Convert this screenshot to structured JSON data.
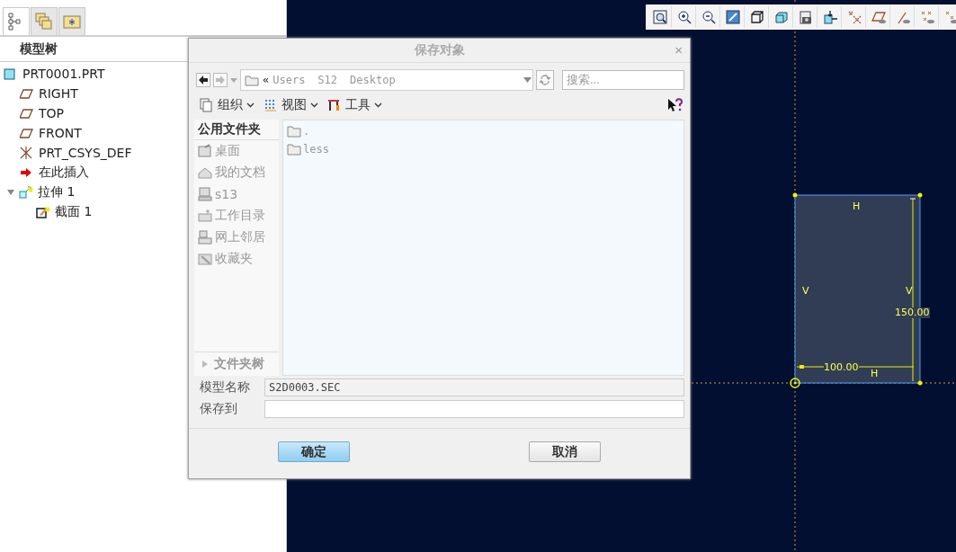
{
  "model_tree": {
    "tabs": [
      {
        "kind": "tree",
        "selected": true
      },
      {
        "kind": "layers",
        "selected": false
      },
      {
        "kind": "favorites",
        "selected": false
      }
    ],
    "title": "模型树",
    "items": [
      {
        "kind": "part",
        "label": "PRT0001.PRT",
        "children": [
          {
            "kind": "plane",
            "label": "RIGHT"
          },
          {
            "kind": "plane",
            "label": "TOP"
          },
          {
            "kind": "plane",
            "label": "FRONT"
          },
          {
            "kind": "csys",
            "label": "PRT_CSYS_DEF"
          },
          {
            "kind": "insert",
            "label": "在此插入"
          },
          {
            "kind": "extrude",
            "label": "拉伸 1",
            "expanded": true,
            "children": [
              {
                "kind": "sketch",
                "label": "截面 1"
              }
            ]
          }
        ]
      }
    ]
  },
  "dialog": {
    "title": "保存对象",
    "close": "×",
    "address": {
      "prefix": "«",
      "segments": [
        "Users",
        "S12",
        "Desktop"
      ]
    },
    "search": {
      "placeholder": "搜索..."
    },
    "menus": [
      {
        "kind": "organize",
        "label": "组织"
      },
      {
        "kind": "view",
        "label": "视图"
      },
      {
        "kind": "tools",
        "label": "工具"
      }
    ],
    "sidebar": {
      "heading": "公用文件夹",
      "items": [
        {
          "kind": "desktop",
          "label": "桌面"
        },
        {
          "kind": "documents",
          "label": "我的文档"
        },
        {
          "kind": "computer",
          "label": "s13"
        },
        {
          "kind": "workdir",
          "label": "工作目录"
        },
        {
          "kind": "network",
          "label": "网上邻居"
        },
        {
          "kind": "favorites",
          "label": "收藏夹"
        }
      ],
      "folder_tree": {
        "label": "文件夹树",
        "expanded": false
      }
    },
    "files": [
      ".",
      "less"
    ],
    "fields": [
      {
        "label": "模型名称",
        "value": "S2D0003.SEC",
        "disabled": true
      },
      {
        "label": "保存到",
        "disabled": false
      }
    ],
    "buttons": [
      {
        "label": "确定",
        "default": true
      },
      {
        "label": "取消",
        "default": false
      }
    ]
  },
  "sketch": {
    "top_constraint": "H",
    "left_constraint": "V",
    "right_constraint": "V",
    "bottom_constraint": "H",
    "height_dimension": "150.00",
    "width_dimension": "100.00"
  }
}
